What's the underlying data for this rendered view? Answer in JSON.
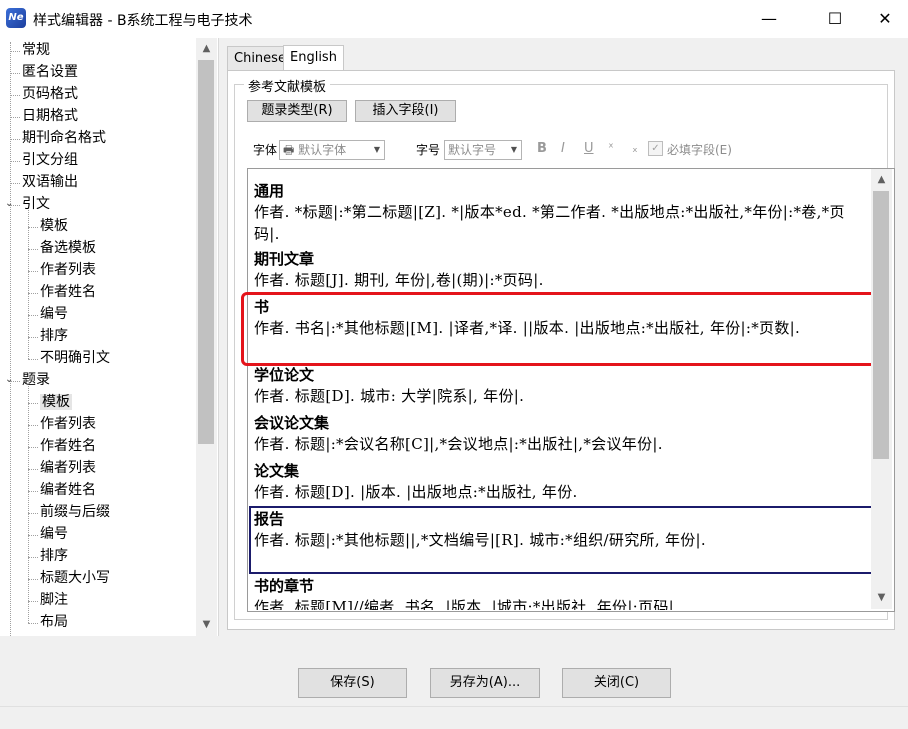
{
  "window": {
    "icon": "Ne",
    "title": "样式编辑器 - B系统工程与电子技术",
    "minimize": "—",
    "maximize": "☐",
    "close": "✕"
  },
  "tree": [
    {
      "label": "常规",
      "level": 0
    },
    {
      "label": "匿名设置",
      "level": 0
    },
    {
      "label": "页码格式",
      "level": 0
    },
    {
      "label": "日期格式",
      "level": 0
    },
    {
      "label": "期刊命名格式",
      "level": 0
    },
    {
      "label": "引文分组",
      "level": 0
    },
    {
      "label": "双语输出",
      "level": 0
    },
    {
      "label": "引文",
      "level": 0,
      "expandable": true
    },
    {
      "label": "模板",
      "level": 1
    },
    {
      "label": "备选模板",
      "level": 1
    },
    {
      "label": "作者列表",
      "level": 1
    },
    {
      "label": "作者姓名",
      "level": 1
    },
    {
      "label": "编号",
      "level": 1
    },
    {
      "label": "排序",
      "level": 1
    },
    {
      "label": "不明确引文",
      "level": 1
    },
    {
      "label": "题录",
      "level": 0,
      "expandable": true
    },
    {
      "label": "模板",
      "level": 1,
      "selected": true
    },
    {
      "label": "作者列表",
      "level": 1
    },
    {
      "label": "作者姓名",
      "level": 1
    },
    {
      "label": "编者列表",
      "level": 1
    },
    {
      "label": "编者姓名",
      "level": 1
    },
    {
      "label": "前缀与后缀",
      "level": 1
    },
    {
      "label": "编号",
      "level": 1
    },
    {
      "label": "排序",
      "level": 1
    },
    {
      "label": "标题大小写",
      "level": 1
    },
    {
      "label": "脚注",
      "level": 1
    },
    {
      "label": "布局",
      "level": 1
    }
  ],
  "tabs": [
    "Chinese",
    "English"
  ],
  "active_tab": "English",
  "group_title": "参考文献模板",
  "buttons": {
    "record_type": "题录类型(R)",
    "insert_field": "插入字段(I)",
    "save": "保存(S)",
    "save_as": "另存为(A)...",
    "close": "关闭(C)"
  },
  "format_bar": {
    "font_label": "字体",
    "font_value": "默认字体",
    "size_label": "字号",
    "size_value": "默认字号",
    "bold": "B",
    "italic": "I",
    "underline": "U",
    "superscript": "ˣ",
    "subscript": "ₓ",
    "required_label": "必填字段(E)"
  },
  "entries": [
    {
      "title": "通用",
      "body": "作者. *标题|:*第二标题|[Z]. *|版本*ed. *第二作者. *出版地点:*出版社,*年份|:*卷,*页码|."
    },
    {
      "title": "期刊文章",
      "body": "作者. 标题[J]. 期刊, 年份|,卷|(期)|:*页码|."
    },
    {
      "title": "书",
      "body": "作者. 书名|:*其他标题|[M]. |译者,*译. ||版本. |出版地点:*出版社, 年份|:*页数|."
    },
    {
      "title": "学位论文",
      "body": "作者. 标题[D]. 城市: 大学|院系|, 年份|."
    },
    {
      "title": "会议论文集",
      "body": "作者. 标题|:*会议名称[C]|,*会议地点|:*出版社|,*会议年份|."
    },
    {
      "title": "论文集",
      "body": "作者. 标题[D]. |版本. |出版地点:*出版社, 年份."
    },
    {
      "title": "报告",
      "body": "作者. 标题|:*其他标题||,*文档编号|[R]. 城市:*组织/研究所, 年份|."
    },
    {
      "title": "书的章节",
      "body": "作者. 标题[M]//编者. 书名. |版本. |城市:*出版社, 年份|:页码|"
    }
  ]
}
